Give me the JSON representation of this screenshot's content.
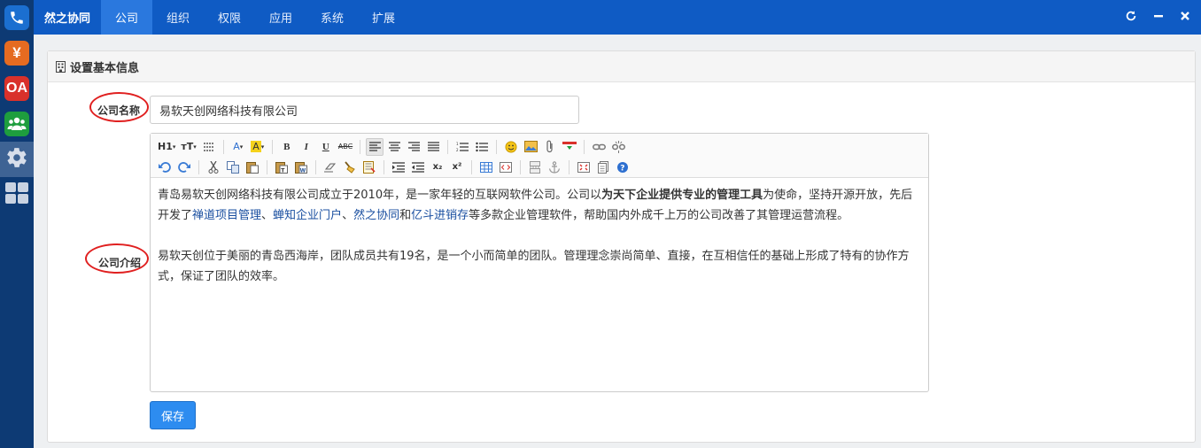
{
  "dock": {
    "items": [
      {
        "icon": "phone-icon"
      },
      {
        "icon": "yen-icon",
        "glyph": "¥"
      },
      {
        "icon": "oa-icon",
        "glyph": "OA"
      },
      {
        "icon": "team-icon"
      },
      {
        "icon": "gear-icon"
      },
      {
        "icon": "grid-icon"
      }
    ]
  },
  "topbar": {
    "brand": "然之协同",
    "tabs": [
      "公司",
      "组织",
      "权限",
      "应用",
      "系统",
      "扩展"
    ],
    "active_tab": "公司"
  },
  "panel": {
    "title": "设置基本信息"
  },
  "form": {
    "name_label": "公司名称",
    "name_value": "易软天创网络科技有限公司",
    "intro_label": "公司介绍",
    "save_label": "保存"
  },
  "toolbar": {
    "row1": [
      "H1",
      "тT",
      "A",
      "A",
      "B",
      "I",
      "U",
      "ABC"
    ],
    "row2": [
      "x₂",
      "x²"
    ]
  },
  "intro": {
    "p1_a": "青岛易软天创网络科技有限公司成立于2010年，是一家年轻的互联网软件公司。公司以",
    "p1_bold": "为天下企业提供专业的管理工具",
    "p1_b": "为使命，坚持开源开放，先后开发了",
    "link1": "禅道项目管理",
    "sep1": "、",
    "link2": "蝉知企业门户",
    "sep2": "、",
    "link3": "然之协同",
    "and": "和",
    "link4": "亿斗进销存",
    "p1_c": "等多款企业管理软件，帮助国内外成千上万的公司改善了其管理运营流程。",
    "p2": "易软天创位于美丽的青岛西海岸，团队成员共有19名，是一个小而简单的团队。管理理念崇尚简单、直接，在互相信任的基础上形成了特有的协作方式，保证了团队的效率。"
  },
  "colors": {
    "topbar": "#0f5bc4",
    "dock": "#0d3a74",
    "annotation_ring": "#e02020",
    "save_button": "#2d8cf0"
  }
}
